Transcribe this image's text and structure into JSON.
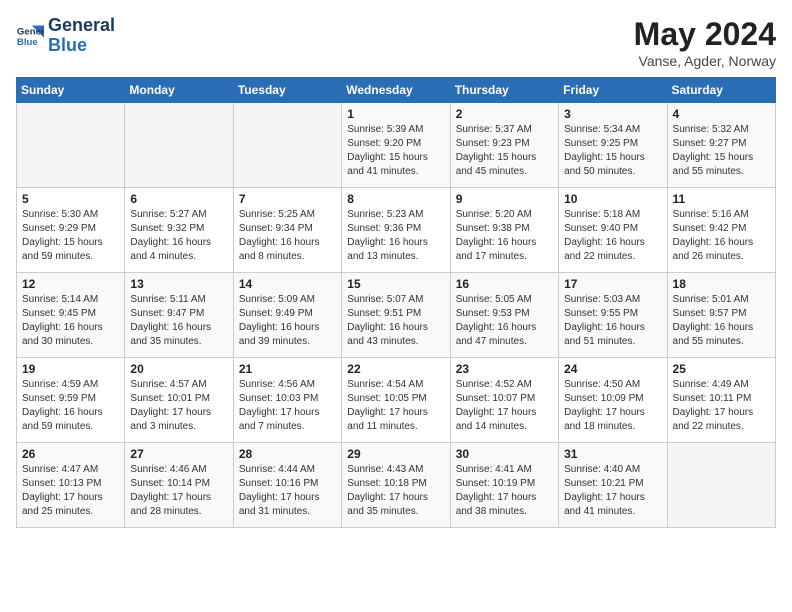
{
  "header": {
    "logo_line1": "General",
    "logo_line2": "Blue",
    "month": "May 2024",
    "location": "Vanse, Agder, Norway"
  },
  "weekdays": [
    "Sunday",
    "Monday",
    "Tuesday",
    "Wednesday",
    "Thursday",
    "Friday",
    "Saturday"
  ],
  "weeks": [
    [
      {
        "day": "",
        "info": ""
      },
      {
        "day": "",
        "info": ""
      },
      {
        "day": "",
        "info": ""
      },
      {
        "day": "1",
        "info": "Sunrise: 5:39 AM\nSunset: 9:20 PM\nDaylight: 15 hours\nand 41 minutes."
      },
      {
        "day": "2",
        "info": "Sunrise: 5:37 AM\nSunset: 9:23 PM\nDaylight: 15 hours\nand 45 minutes."
      },
      {
        "day": "3",
        "info": "Sunrise: 5:34 AM\nSunset: 9:25 PM\nDaylight: 15 hours\nand 50 minutes."
      },
      {
        "day": "4",
        "info": "Sunrise: 5:32 AM\nSunset: 9:27 PM\nDaylight: 15 hours\nand 55 minutes."
      }
    ],
    [
      {
        "day": "5",
        "info": "Sunrise: 5:30 AM\nSunset: 9:29 PM\nDaylight: 15 hours\nand 59 minutes."
      },
      {
        "day": "6",
        "info": "Sunrise: 5:27 AM\nSunset: 9:32 PM\nDaylight: 16 hours\nand 4 minutes."
      },
      {
        "day": "7",
        "info": "Sunrise: 5:25 AM\nSunset: 9:34 PM\nDaylight: 16 hours\nand 8 minutes."
      },
      {
        "day": "8",
        "info": "Sunrise: 5:23 AM\nSunset: 9:36 PM\nDaylight: 16 hours\nand 13 minutes."
      },
      {
        "day": "9",
        "info": "Sunrise: 5:20 AM\nSunset: 9:38 PM\nDaylight: 16 hours\nand 17 minutes."
      },
      {
        "day": "10",
        "info": "Sunrise: 5:18 AM\nSunset: 9:40 PM\nDaylight: 16 hours\nand 22 minutes."
      },
      {
        "day": "11",
        "info": "Sunrise: 5:16 AM\nSunset: 9:42 PM\nDaylight: 16 hours\nand 26 minutes."
      }
    ],
    [
      {
        "day": "12",
        "info": "Sunrise: 5:14 AM\nSunset: 9:45 PM\nDaylight: 16 hours\nand 30 minutes."
      },
      {
        "day": "13",
        "info": "Sunrise: 5:11 AM\nSunset: 9:47 PM\nDaylight: 16 hours\nand 35 minutes."
      },
      {
        "day": "14",
        "info": "Sunrise: 5:09 AM\nSunset: 9:49 PM\nDaylight: 16 hours\nand 39 minutes."
      },
      {
        "day": "15",
        "info": "Sunrise: 5:07 AM\nSunset: 9:51 PM\nDaylight: 16 hours\nand 43 minutes."
      },
      {
        "day": "16",
        "info": "Sunrise: 5:05 AM\nSunset: 9:53 PM\nDaylight: 16 hours\nand 47 minutes."
      },
      {
        "day": "17",
        "info": "Sunrise: 5:03 AM\nSunset: 9:55 PM\nDaylight: 16 hours\nand 51 minutes."
      },
      {
        "day": "18",
        "info": "Sunrise: 5:01 AM\nSunset: 9:57 PM\nDaylight: 16 hours\nand 55 minutes."
      }
    ],
    [
      {
        "day": "19",
        "info": "Sunrise: 4:59 AM\nSunset: 9:59 PM\nDaylight: 16 hours\nand 59 minutes."
      },
      {
        "day": "20",
        "info": "Sunrise: 4:57 AM\nSunset: 10:01 PM\nDaylight: 17 hours\nand 3 minutes."
      },
      {
        "day": "21",
        "info": "Sunrise: 4:56 AM\nSunset: 10:03 PM\nDaylight: 17 hours\nand 7 minutes."
      },
      {
        "day": "22",
        "info": "Sunrise: 4:54 AM\nSunset: 10:05 PM\nDaylight: 17 hours\nand 11 minutes."
      },
      {
        "day": "23",
        "info": "Sunrise: 4:52 AM\nSunset: 10:07 PM\nDaylight: 17 hours\nand 14 minutes."
      },
      {
        "day": "24",
        "info": "Sunrise: 4:50 AM\nSunset: 10:09 PM\nDaylight: 17 hours\nand 18 minutes."
      },
      {
        "day": "25",
        "info": "Sunrise: 4:49 AM\nSunset: 10:11 PM\nDaylight: 17 hours\nand 22 minutes."
      }
    ],
    [
      {
        "day": "26",
        "info": "Sunrise: 4:47 AM\nSunset: 10:13 PM\nDaylight: 17 hours\nand 25 minutes."
      },
      {
        "day": "27",
        "info": "Sunrise: 4:46 AM\nSunset: 10:14 PM\nDaylight: 17 hours\nand 28 minutes."
      },
      {
        "day": "28",
        "info": "Sunrise: 4:44 AM\nSunset: 10:16 PM\nDaylight: 17 hours\nand 31 minutes."
      },
      {
        "day": "29",
        "info": "Sunrise: 4:43 AM\nSunset: 10:18 PM\nDaylight: 17 hours\nand 35 minutes."
      },
      {
        "day": "30",
        "info": "Sunrise: 4:41 AM\nSunset: 10:19 PM\nDaylight: 17 hours\nand 38 minutes."
      },
      {
        "day": "31",
        "info": "Sunrise: 4:40 AM\nSunset: 10:21 PM\nDaylight: 17 hours\nand 41 minutes."
      },
      {
        "day": "",
        "info": ""
      }
    ]
  ]
}
